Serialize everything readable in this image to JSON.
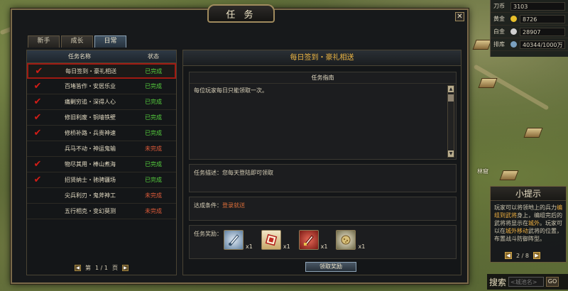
{
  "window": {
    "title": "任 务",
    "close": "✕"
  },
  "tabs": [
    "新手",
    "成长",
    "日常"
  ],
  "list": {
    "headers": {
      "name": "任务名称",
      "status": "状态"
    },
    "rows": [
      {
        "checked": true,
        "name": "每日签到・豪礼相送",
        "status": "已完成",
        "done": true
      },
      {
        "checked": true,
        "name": "百堵皆作・安居乐业",
        "status": "已完成",
        "done": true
      },
      {
        "checked": true,
        "name": "痛剿穷追・深得人心",
        "status": "已完成",
        "done": true
      },
      {
        "checked": true,
        "name": "修旧利废・铜墙铁壁",
        "status": "已完成",
        "done": true
      },
      {
        "checked": true,
        "name": "修桥补路・兵贵神速",
        "status": "已完成",
        "done": true
      },
      {
        "checked": false,
        "name": "兵马不动・神运鬼输",
        "status": "未完成",
        "done": false
      },
      {
        "checked": true,
        "name": "物尽其用・棒山煮海",
        "status": "已完成",
        "done": true
      },
      {
        "checked": true,
        "name": "招贤纳士・驰骋疆场",
        "status": "已完成",
        "done": true
      },
      {
        "checked": false,
        "name": "尖兵利刃・鬼斧神工",
        "status": "未完成",
        "done": false
      },
      {
        "checked": false,
        "name": "五行相克・变幻莫测",
        "status": "未完成",
        "done": false
      }
    ],
    "pager": {
      "prev_word": "第",
      "page": "1 / 1",
      "next_word": "页"
    }
  },
  "detail": {
    "title": "每日签到・豪礼相送",
    "guide_title": "任务指南",
    "guide_text": "每位玩家每日只能领取一次。",
    "desc": "任务描述：您每天登陆即可领取",
    "cond_label": "达成条件：",
    "cond_link": "登录就送",
    "reward_label": "任务奖励：",
    "rewards": [
      {
        "qty": "x1",
        "icon": "sword-token-icon"
      },
      {
        "qty": "x1",
        "icon": "scroll-seal-icon"
      },
      {
        "qty": "x1",
        "icon": "red-blade-icon"
      },
      {
        "qty": "x1",
        "icon": "grain-bundle-icon"
      }
    ],
    "claim": "领取奖励"
  },
  "stats": [
    {
      "label": "刀币",
      "value": "3103",
      "color": "#c0a050"
    },
    {
      "label": "黄金",
      "value": "8726",
      "color": "#e8c02a"
    },
    {
      "label": "白金",
      "value": "28907",
      "color": "#d0d0d0"
    },
    {
      "label": "排库",
      "value": "40344/1000万",
      "color": ""
    }
  ],
  "map_labels": [
    "林窟"
  ],
  "tips": {
    "title": "小提示",
    "pre": "玩家可以将领地上的兵力",
    "hl1": "编组到武将",
    "mid": "身上，编组完后的武将将显示在",
    "hl2": "城外",
    "mid2": "。玩家可以在",
    "hl3": "城外移动",
    "post": "武将的位置，布置战斗防御阵型。",
    "page": "2 / 8"
  },
  "search": {
    "label": "搜索",
    "placeholder": "<城池名>",
    "go": "GO"
  }
}
